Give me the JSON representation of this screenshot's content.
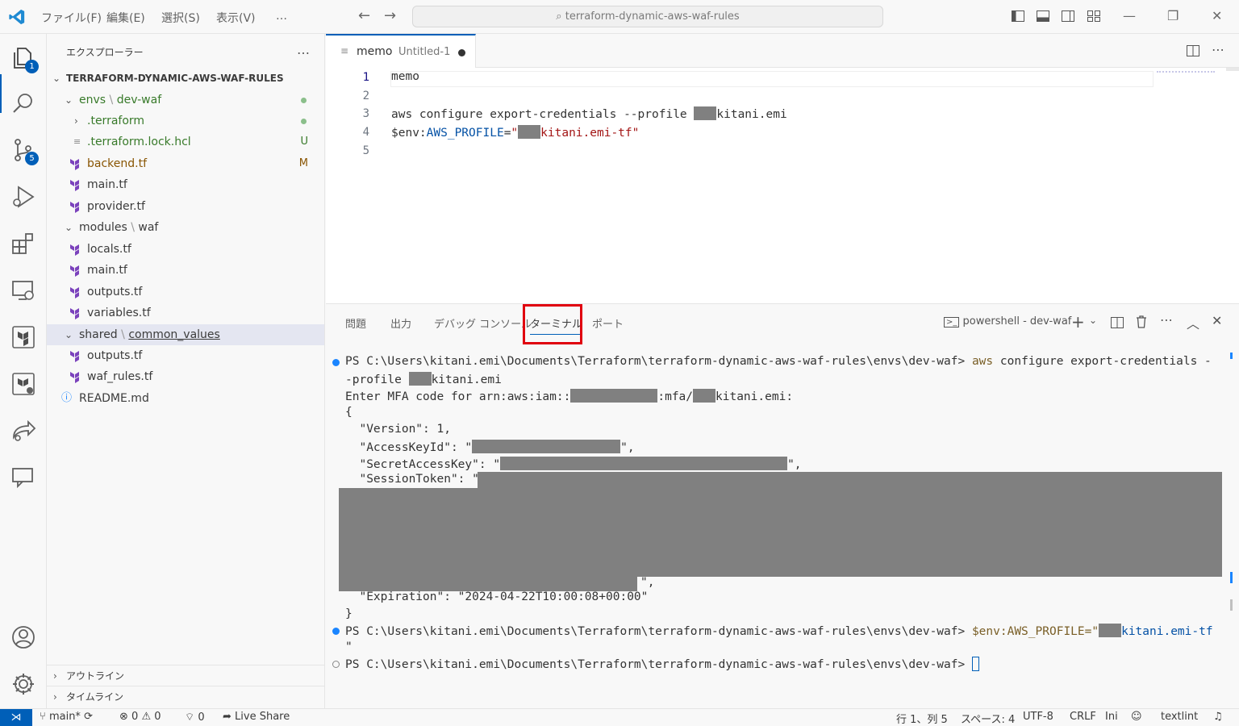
{
  "titlebar": {
    "menus": [
      "ファイル(F)",
      "編集(E)",
      "選択(S)",
      "表示(V)",
      "…"
    ],
    "search": "terraform-dynamic-aws-waf-rules"
  },
  "activity": {
    "explorer_badge": "1",
    "scm_badge": "5"
  },
  "sidebar": {
    "title": "エクスプローラー",
    "more": "…",
    "root": "TERRAFORM-DYNAMIC-AWS-WAF-RULES",
    "items": [
      {
        "label_a": "envs",
        "label_b": "dev-waf"
      },
      {
        "label": ".terraform"
      },
      {
        "label": ".terraform.lock.hcl",
        "status": "U"
      },
      {
        "label": "backend.tf",
        "status": "M"
      },
      {
        "label": "main.tf"
      },
      {
        "label": "provider.tf"
      },
      {
        "label_a": "modules",
        "label_b": "waf"
      },
      {
        "label": "locals.tf"
      },
      {
        "label": "main.tf"
      },
      {
        "label": "outputs.tf"
      },
      {
        "label": "variables.tf"
      },
      {
        "label_a": "shared",
        "label_b": "common_values"
      },
      {
        "label": "outputs.tf"
      },
      {
        "label": "waf_rules.tf"
      },
      {
        "label": "README.md"
      }
    ],
    "outline": "アウトライン",
    "timeline": "タイムライン"
  },
  "editor": {
    "tab_title": "memo",
    "tab_subtitle": "Untitled-1",
    "line_numbers": [
      "1",
      "2",
      "3",
      "4",
      "5"
    ],
    "line1": "memo",
    "line3_a": "aws configure export-credentials --profile ",
    "line3_b": "kitani.emi",
    "line4_a": "$env:",
    "line4_b": "AWS_PROFILE",
    "line4_c": "=",
    "line4_d": "\"",
    "line4_e": "kitani.emi-tf\""
  },
  "panel": {
    "tabs": [
      "問題",
      "出力",
      "デバッグ コンソール",
      "ターミナル",
      "ポート"
    ],
    "terminal_name": "powershell - dev-waf",
    "prompt": "PS C:\\Users\\kitani.emi\\Documents\\Terraform\\terraform-dynamic-aws-waf-rules\\envs\\dev-waf>",
    "cmd1_a": "aws",
    "cmd1_b": " configure export-credentials -",
    "cmd1_c": "-profile ",
    "cmd1_d": "kitani.emi",
    "mfa_a": "Enter MFA code for arn:aws:iam::",
    "mfa_b": ":mfa/",
    "mfa_c": "kitani.emi:",
    "brace_open": "{",
    "version": "  \"Version\": 1,",
    "access_key": "  \"AccessKeyId\": \"",
    "secret_key": "  \"SecretAccessKey\": \"",
    "session_token": "  \"SessionToken\": \"",
    "expiration": "  \"Expiration\": \"2024-04-22T10:00:08+00:00\"",
    "brace_close": "}",
    "cmd2_a": "$env:AWS_PROFILE=\"",
    "cmd2_b": "kitani.emi-tf",
    "cmd2_c": "\""
  },
  "statusbar": {
    "branch": "main*",
    "errors": "0",
    "warnings": "0",
    "ports": "0",
    "live_share": "Live Share",
    "position": "行 1、列 5",
    "spaces": "スペース: 4",
    "encoding": "UTF-8",
    "eol": "CRLF",
    "lang": "Ini",
    "textlint": "textlint"
  },
  "colors": {
    "accent": "#005fb8",
    "highlight_box": "#e0000f",
    "redaction": "#808080"
  }
}
